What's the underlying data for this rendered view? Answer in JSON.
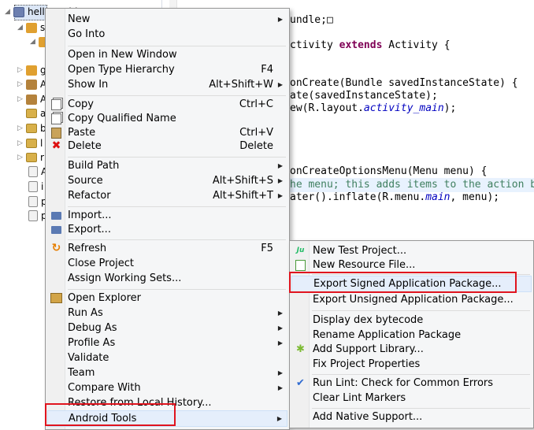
{
  "explorer": {
    "project_name": "helloWorld",
    "rows": [
      {
        "label": "helloWorld",
        "icon": "project-icon"
      },
      {
        "label": "s",
        "icon": "source-folder-icon"
      },
      {
        "label": "",
        "icon": "package-icon"
      },
      {
        "label": "g",
        "icon": "source-folder-icon"
      },
      {
        "label": "A",
        "icon": "library-icon"
      },
      {
        "label": "A",
        "icon": "library-icon"
      },
      {
        "label": "a",
        "icon": "folder-icon"
      },
      {
        "label": "b",
        "icon": "folder-icon"
      },
      {
        "label": "l",
        "icon": "folder-icon"
      },
      {
        "label": "r",
        "icon": "folder-icon"
      },
      {
        "label": "A",
        "icon": "file-icon"
      },
      {
        "label": "i",
        "icon": "file-icon"
      },
      {
        "label": "p",
        "icon": "file-icon"
      },
      {
        "label": "p",
        "icon": "file-icon"
      }
    ]
  },
  "editor": {
    "lines": [
      {
        "parts": [
          {
            "t": "undle;",
            "c": ""
          },
          {
            "t": "□",
            "c": ""
          }
        ]
      },
      {
        "parts": [
          {
            "t": "ctivity ",
            "c": ""
          },
          {
            "t": "extends",
            "c": "kw"
          },
          {
            "t": " Activity {",
            "c": ""
          }
        ]
      },
      {
        "parts": [
          {
            "t": "onCreate(Bundle savedInstanceState) {",
            "c": ""
          }
        ]
      },
      {
        "parts": [
          {
            "t": "ate(savedInstanceState);",
            "c": ""
          }
        ]
      },
      {
        "parts": [
          {
            "t": "ew(R.layout.",
            "c": ""
          },
          {
            "t": "activity_main",
            "c": "it"
          },
          {
            "t": ");",
            "c": ""
          }
        ]
      },
      {
        "parts": [
          {
            "t": "onCreateOptionsMenu(Menu menu) {",
            "c": ""
          }
        ]
      },
      {
        "parts": [
          {
            "t": "he menu; this adds items to the action bar",
            "c": "cm"
          }
        ]
      },
      {
        "parts": [
          {
            "t": "ater().inflate(R.menu.",
            "c": ""
          },
          {
            "t": "main",
            "c": "it"
          },
          {
            "t": ", menu);",
            "c": ""
          }
        ]
      }
    ]
  },
  "context_menu": {
    "items": [
      {
        "label": "New",
        "shortcut": "",
        "submenu": true,
        "icon": ""
      },
      {
        "label": "Go Into",
        "shortcut": "",
        "submenu": false,
        "icon": ""
      },
      {
        "label": "Open in New Window",
        "shortcut": "",
        "submenu": false,
        "icon": ""
      },
      {
        "label": "Open Type Hierarchy",
        "shortcut": "F4",
        "submenu": false,
        "icon": ""
      },
      {
        "label": "Show In",
        "shortcut": "Alt+Shift+W",
        "submenu": true,
        "icon": ""
      },
      {
        "label": "Copy",
        "shortcut": "Ctrl+C",
        "submenu": false,
        "icon": "copy-icon"
      },
      {
        "label": "Copy Qualified Name",
        "shortcut": "",
        "submenu": false,
        "icon": "copy-icon"
      },
      {
        "label": "Paste",
        "shortcut": "Ctrl+V",
        "submenu": false,
        "icon": "paste-icon"
      },
      {
        "label": "Delete",
        "shortcut": "Delete",
        "submenu": false,
        "icon": "delete-icon"
      },
      {
        "label": "Build Path",
        "shortcut": "",
        "submenu": true,
        "icon": ""
      },
      {
        "label": "Source",
        "shortcut": "Alt+Shift+S",
        "submenu": true,
        "icon": ""
      },
      {
        "label": "Refactor",
        "shortcut": "Alt+Shift+T",
        "submenu": true,
        "icon": ""
      },
      {
        "label": "Import...",
        "shortcut": "",
        "submenu": false,
        "icon": "import-icon"
      },
      {
        "label": "Export...",
        "shortcut": "",
        "submenu": false,
        "icon": "export-icon"
      },
      {
        "label": "Refresh",
        "shortcut": "F5",
        "submenu": false,
        "icon": "refresh-icon"
      },
      {
        "label": "Close Project",
        "shortcut": "",
        "submenu": false,
        "icon": ""
      },
      {
        "label": "Assign Working Sets...",
        "shortcut": "",
        "submenu": false,
        "icon": ""
      },
      {
        "label": "Open Explorer",
        "shortcut": "",
        "submenu": false,
        "icon": "explorer-icon"
      },
      {
        "label": "Run As",
        "shortcut": "",
        "submenu": true,
        "icon": ""
      },
      {
        "label": "Debug As",
        "shortcut": "",
        "submenu": true,
        "icon": ""
      },
      {
        "label": "Profile As",
        "shortcut": "",
        "submenu": true,
        "icon": ""
      },
      {
        "label": "Validate",
        "shortcut": "",
        "submenu": false,
        "icon": ""
      },
      {
        "label": "Team",
        "shortcut": "",
        "submenu": true,
        "icon": ""
      },
      {
        "label": "Compare With",
        "shortcut": "",
        "submenu": true,
        "icon": ""
      },
      {
        "label": "Restore from Local History...",
        "shortcut": "",
        "submenu": false,
        "icon": ""
      },
      {
        "label": "Android Tools",
        "shortcut": "",
        "submenu": true,
        "icon": ""
      }
    ]
  },
  "android_tools_menu": {
    "items": [
      {
        "label": "New Test Project...",
        "icon": "junit-icon"
      },
      {
        "label": "New Resource File...",
        "icon": "resource-file-icon"
      },
      {
        "label": "Export Signed Application Package...",
        "icon": ""
      },
      {
        "label": "Export Unsigned Application Package...",
        "icon": ""
      },
      {
        "label": "Display dex bytecode",
        "icon": ""
      },
      {
        "label": "Rename Application Package",
        "icon": ""
      },
      {
        "label": "Add Support Library...",
        "icon": "android-icon"
      },
      {
        "label": "Fix Project Properties",
        "icon": ""
      },
      {
        "label": "Run Lint: Check for Common Errors",
        "icon": "lint-check-icon"
      },
      {
        "label": "Clear Lint Markers",
        "icon": ""
      },
      {
        "label": "Add Native Support...",
        "icon": ""
      }
    ]
  },
  "colors": {
    "highlight_box": "#e0141e",
    "menu_bg": "#f5f6f7",
    "selected_bg": "#e5eefb"
  }
}
